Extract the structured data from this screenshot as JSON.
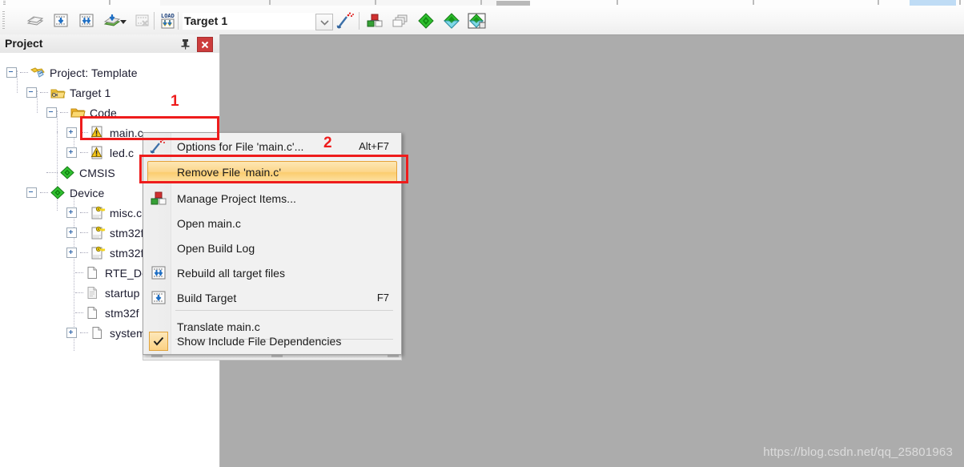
{
  "toolbar": {
    "buttons": [
      {
        "name": "translate-icon",
        "title": "Translate"
      },
      {
        "name": "build-target-icon",
        "title": "Build"
      },
      {
        "name": "rebuild-all-icon",
        "title": "Rebuild"
      },
      {
        "name": "batch-build-icon",
        "title": "Batch Build"
      },
      {
        "name": "stop-build-icon",
        "title": "Stop Build"
      },
      {
        "name": "load-download-icon",
        "title": "Download"
      }
    ],
    "target_value": "Target 1",
    "combo_arrow_icon": "chevron-down-icon",
    "right_buttons": [
      {
        "name": "target-options-wizard-icon",
        "title": "Options for Target"
      },
      {
        "name": "manage-project-items-icon",
        "title": "Manage Project Items"
      },
      {
        "name": "multi-project-icon",
        "title": "Manage Multi-Project"
      },
      {
        "name": "pack-installer-green-icon",
        "title": "Pack Installer"
      },
      {
        "name": "run-time-env-icon",
        "title": "Manage Run-Time Environment"
      },
      {
        "name": "select-software-packs-icon",
        "title": "Select Software Packs"
      }
    ]
  },
  "project_panel": {
    "title": "Project",
    "pin_icon": "pin-icon",
    "close_icon": "close-icon",
    "tree": [
      {
        "label": "Project: Template",
        "icon": "project-icon",
        "indent": 0,
        "expander": "minus"
      },
      {
        "label": "Target 1",
        "icon": "target-icon",
        "indent": 1,
        "expander": "minus"
      },
      {
        "label": "Code",
        "icon": "folder-icon",
        "indent": 2,
        "expander": "minus"
      },
      {
        "label": "main.c",
        "icon": "c-warn-icon",
        "indent": 3,
        "expander": "plus"
      },
      {
        "label": "led.c",
        "icon": "c-warn-icon",
        "indent": 3,
        "expander": "plus"
      },
      {
        "label": "CMSIS",
        "icon": "component-icon",
        "indent": 2,
        "expander": "none"
      },
      {
        "label": "Device",
        "icon": "component-icon",
        "indent": 2,
        "expander": "minus"
      },
      {
        "label": "misc.c",
        "icon": "file-key-icon",
        "indent": 3,
        "expander": "plus"
      },
      {
        "label": "stm32f",
        "icon": "file-key-icon",
        "indent": 3,
        "expander": "plus"
      },
      {
        "label": "stm32f",
        "icon": "file-key-icon",
        "indent": 3,
        "expander": "plus"
      },
      {
        "label": "RTE_De",
        "icon": "file-icon",
        "indent": 3,
        "expander": "none"
      },
      {
        "label": "startup",
        "icon": "file-dim-icon",
        "indent": 3,
        "expander": "none"
      },
      {
        "label": "stm32f",
        "icon": "file-icon",
        "indent": 3,
        "expander": "none"
      },
      {
        "label": "system",
        "icon": "file-icon",
        "indent": 3,
        "expander": "plus"
      }
    ]
  },
  "context_menu": {
    "items": [
      {
        "label": "Options for File 'main.c'...",
        "shortcut": "Alt+F7",
        "icon": "options-wizard-icon",
        "selected": false,
        "checked": false
      },
      {
        "label": "Remove File 'main.c'",
        "shortcut": "",
        "icon": "",
        "selected": true,
        "checked": false
      },
      {
        "label": "Manage Project Items...",
        "shortcut": "",
        "icon": "manage-items-icon",
        "selected": false,
        "checked": false
      },
      {
        "label": "Open main.c",
        "shortcut": "",
        "icon": "",
        "selected": false,
        "checked": false
      },
      {
        "label": "Open Build Log",
        "shortcut": "",
        "icon": "",
        "selected": false,
        "checked": false
      },
      {
        "label": "Rebuild all target files",
        "shortcut": "",
        "icon": "rebuild-icon",
        "selected": false,
        "checked": false
      },
      {
        "label": "Build Target",
        "shortcut": "F7",
        "icon": "build-icon",
        "selected": false,
        "checked": false
      },
      {
        "label": "Translate main.c",
        "shortcut": "",
        "icon": "",
        "selected": false,
        "checked": false
      },
      {
        "label": "Show Include File Dependencies",
        "shortcut": "",
        "icon": "checkmark-icon",
        "selected": false,
        "checked": true
      }
    ]
  },
  "annotations": {
    "step_one": "1",
    "step_two": "2"
  },
  "workarea": {
    "watermark": "https://blog.csdn.net/qq_25801963",
    "background_color": "#acacac"
  },
  "colors": {
    "annotation_red": "#ee1c1c",
    "selection_amber": "#fbcd6e",
    "close_button_red": "#cc3c3c",
    "tree_text": "#1b1b2f"
  }
}
